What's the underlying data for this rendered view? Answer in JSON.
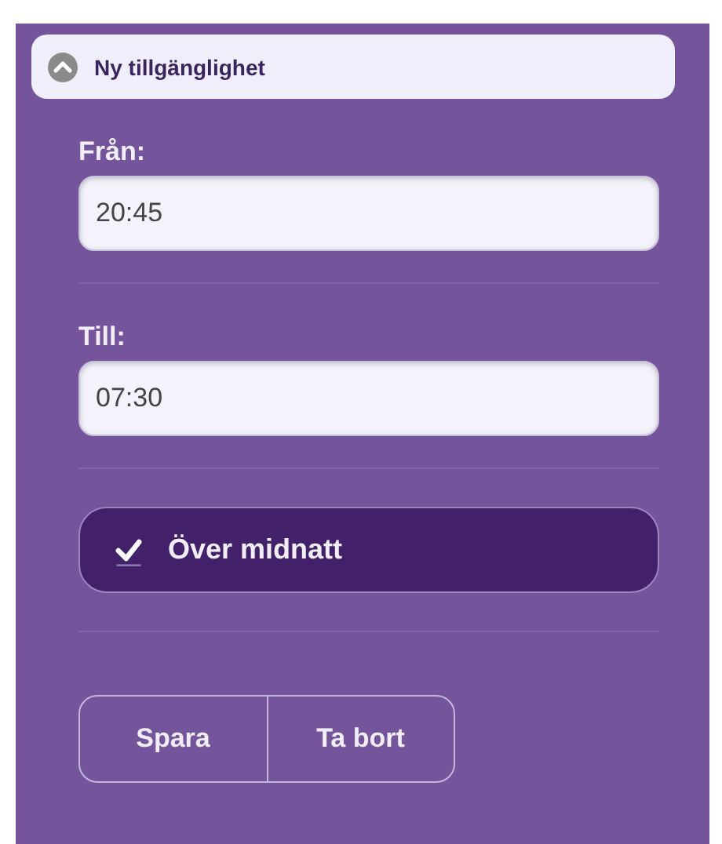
{
  "section": {
    "title": "Ny tillgänglighet",
    "expanded": true
  },
  "fields": [
    {
      "label": "Från:",
      "value": "20:45"
    },
    {
      "label": "Till:",
      "value": "07:30"
    }
  ],
  "overnight": {
    "label": "Över midnatt",
    "checked": true
  },
  "buttons": [
    "Spara",
    "Ta bort"
  ]
}
